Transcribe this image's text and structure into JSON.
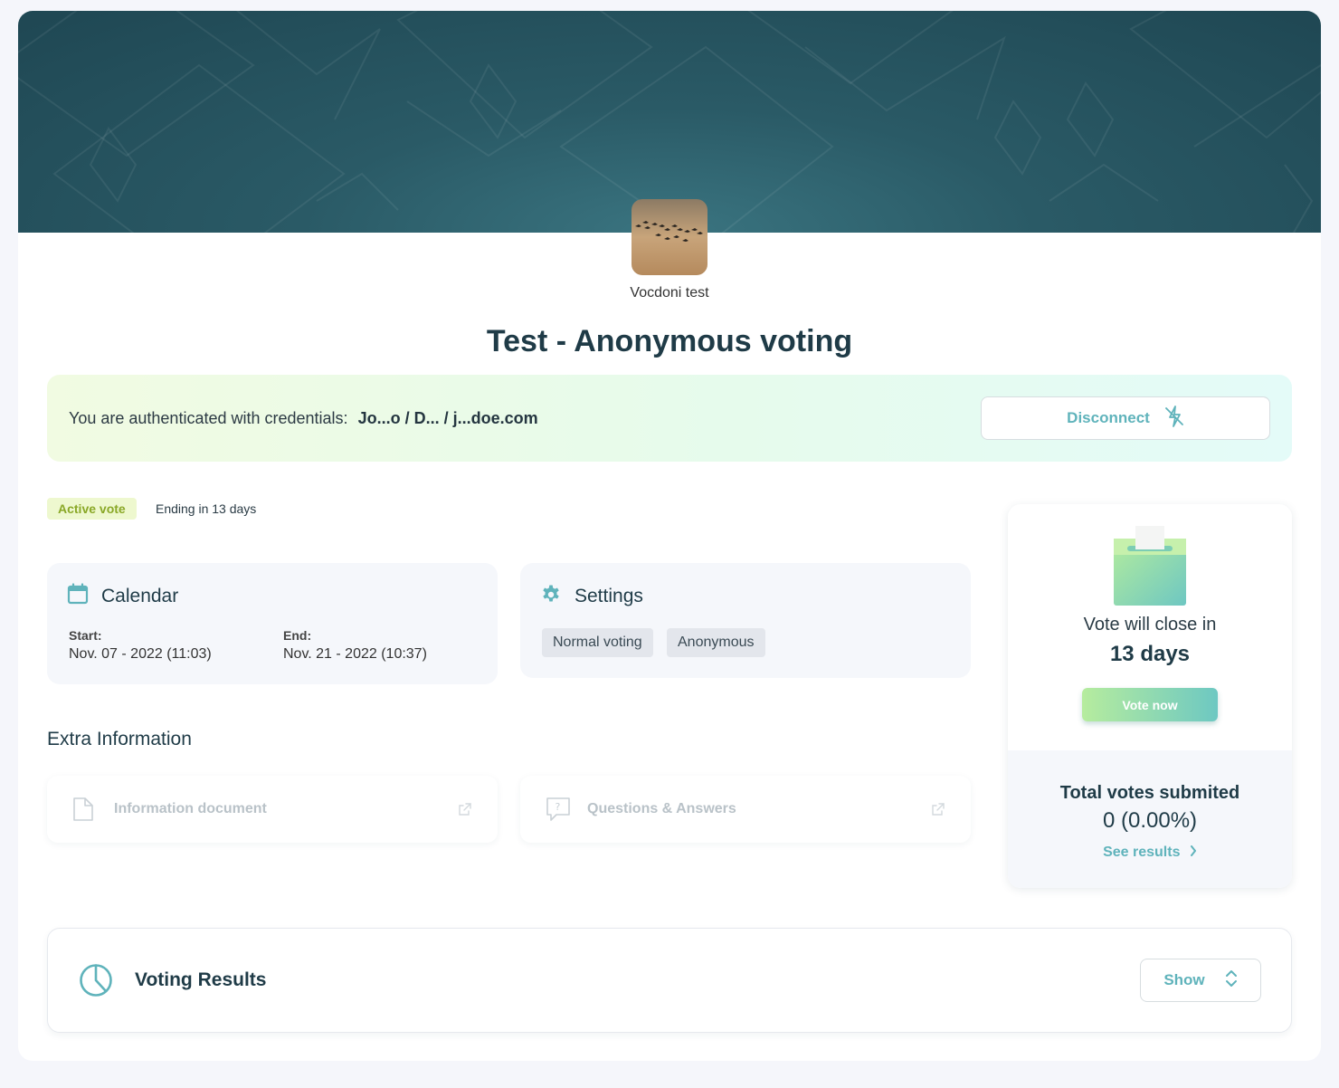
{
  "organization": {
    "name": "Vocdoni test"
  },
  "process": {
    "title": "Test - Anonymous voting"
  },
  "auth": {
    "message": "You are authenticated with credentials:",
    "credentials": "Jo...o / D... / j...doe.com",
    "disconnect_label": "Disconnect"
  },
  "status": {
    "badge": "Active vote",
    "ending": "Ending in 13 days"
  },
  "calendar": {
    "title": "Calendar",
    "start_label": "Start:",
    "start_value": "Nov. 07 - 2022 (11:03)",
    "end_label": "End:",
    "end_value": "Nov. 21 - 2022 (10:37)"
  },
  "settings": {
    "title": "Settings",
    "tags": [
      "Normal voting",
      "Anonymous"
    ]
  },
  "extra": {
    "title": "Extra Information",
    "links": [
      {
        "label": "Information document",
        "icon": "document-icon"
      },
      {
        "label": "Questions & Answers",
        "icon": "question-bubble-icon"
      }
    ]
  },
  "vote_panel": {
    "close_text": "Vote will close in",
    "close_days": "13 days",
    "vote_button": "Vote now",
    "total_label": "Total votes submited",
    "total_value": "0 (0.00%)",
    "see_results": "See results"
  },
  "results": {
    "title": "Voting Results",
    "show_label": "Show"
  },
  "colors": {
    "accent": "#5fb3bb",
    "banner": "#2a5a66",
    "badge_bg": "#eef8cf",
    "badge_text": "#8aa827"
  }
}
